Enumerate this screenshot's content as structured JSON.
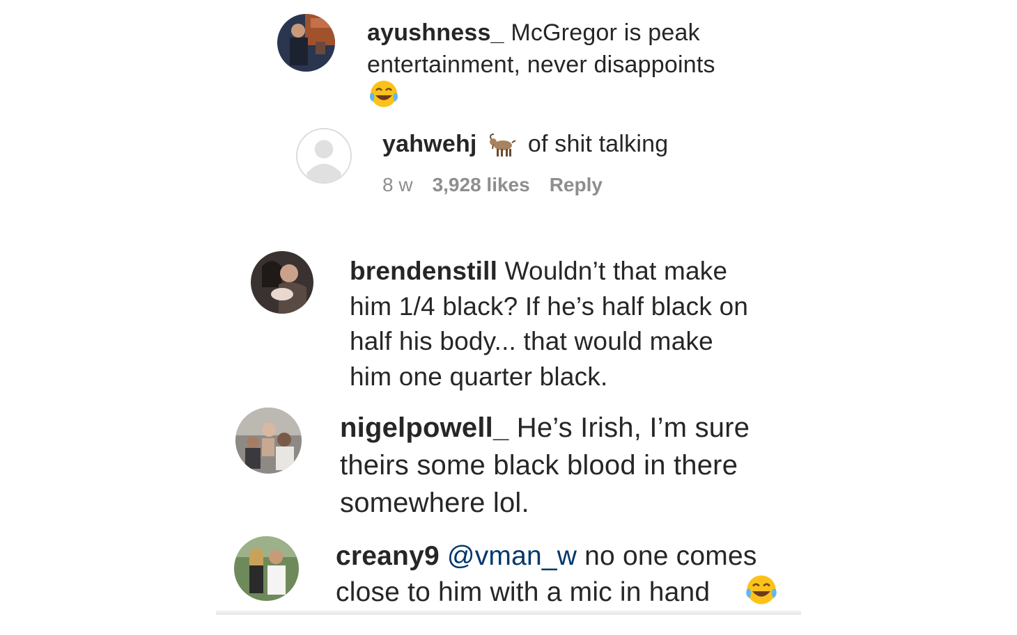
{
  "comments": [
    {
      "username": "ayushness_",
      "line1": " McGregor is peak",
      "line2": "entertainment, never disappoints",
      "emoji": "face-with-tears-of-joy-icon"
    },
    {
      "username": "yahwehj",
      "emoji": "goat-icon",
      "text": " of shit talking",
      "time": "8 w",
      "likes": "3,928 likes",
      "reply": "Reply"
    },
    {
      "username": "brendenstill",
      "line1": " Wouldn’t that make",
      "line2": "him 1/4 black? If he’s half black on",
      "line3": "half his body... that would make",
      "line4": "him one quarter black."
    },
    {
      "username": "nigelpowell_",
      "line1": " He’s Irish, I’m sure",
      "line2": "theirs some black blood in there",
      "line3": "somewhere lol."
    },
    {
      "username": "creany9",
      "mention": "@vman_w",
      "line1": " no one comes",
      "line2": "close to him with a mic in hand",
      "emoji": "face-with-tears-of-joy-icon"
    }
  ],
  "colors": {
    "text": "#262626",
    "meta": "#8e8e8e",
    "mention": "#00376b",
    "emoji_yellow": "#fcc21b"
  }
}
